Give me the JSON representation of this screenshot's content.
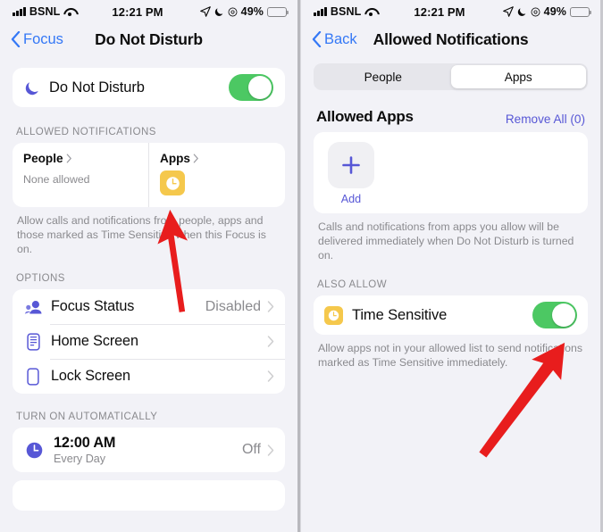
{
  "status_bar": {
    "carrier": "BSNL",
    "time": "12:21 PM",
    "battery_percent": "49%",
    "icons": [
      "signal-bars-icon",
      "wifi-icon",
      "location-arrow-icon",
      "moon-icon",
      "focus-icon",
      "battery-icon"
    ]
  },
  "colors": {
    "accent_blue": "#3478f6",
    "accent_purple": "#5757d6",
    "toggle_green": "#4cc863",
    "app_yellow": "#f5c84c",
    "arrow_red": "#e81d1d",
    "background": "#f2f2f7"
  },
  "left_screen": {
    "nav": {
      "back_label": "Focus",
      "title": "Do Not Disturb"
    },
    "dnd": {
      "label": "Do Not Disturb",
      "toggle_on": true
    },
    "allowed_notifications": {
      "header": "ALLOWED NOTIFICATIONS",
      "people": {
        "title": "People",
        "subtitle": "None allowed"
      },
      "apps": {
        "title": "Apps",
        "app_icon": "clock-app-icon"
      },
      "footer": "Allow calls and notifications from people, apps and those marked as Time Sensitive when this Focus is on."
    },
    "options": {
      "header": "OPTIONS",
      "rows": [
        {
          "label": "Focus Status",
          "value": "Disabled",
          "icon": "focus-status-icon"
        },
        {
          "label": "Home Screen",
          "value": "",
          "icon": "home-screen-icon"
        },
        {
          "label": "Lock Screen",
          "value": "",
          "icon": "lock-screen-icon"
        }
      ]
    },
    "turn_on_automatically": {
      "header": "TURN ON AUTOMATICALLY",
      "schedule": {
        "time": "12:00 AM",
        "repeat": "Every Day",
        "state": "Off",
        "icon": "clock-icon"
      }
    }
  },
  "right_screen": {
    "nav": {
      "back_label": "Back",
      "title": "Allowed Notifications"
    },
    "segmented": {
      "options": [
        "People",
        "Apps"
      ],
      "selected": "Apps"
    },
    "allowed_apps": {
      "title": "Allowed Apps",
      "remove_all": "Remove All (0)",
      "add_label": "Add",
      "footer": "Calls and notifications from apps you allow will be delivered immediately when Do Not Disturb is turned on."
    },
    "also_allow": {
      "header": "ALSO ALLOW",
      "time_sensitive": {
        "label": "Time Sensitive",
        "toggle_on": true,
        "icon": "clock-app-icon"
      },
      "footer": "Allow apps not in your allowed list to send notifications marked as Time Sensitive immediately."
    }
  },
  "annotations": [
    {
      "name": "arrow-to-apps-icon",
      "color": "#e81d1d"
    },
    {
      "name": "arrow-to-time-sensitive-toggle",
      "color": "#e81d1d"
    }
  ]
}
